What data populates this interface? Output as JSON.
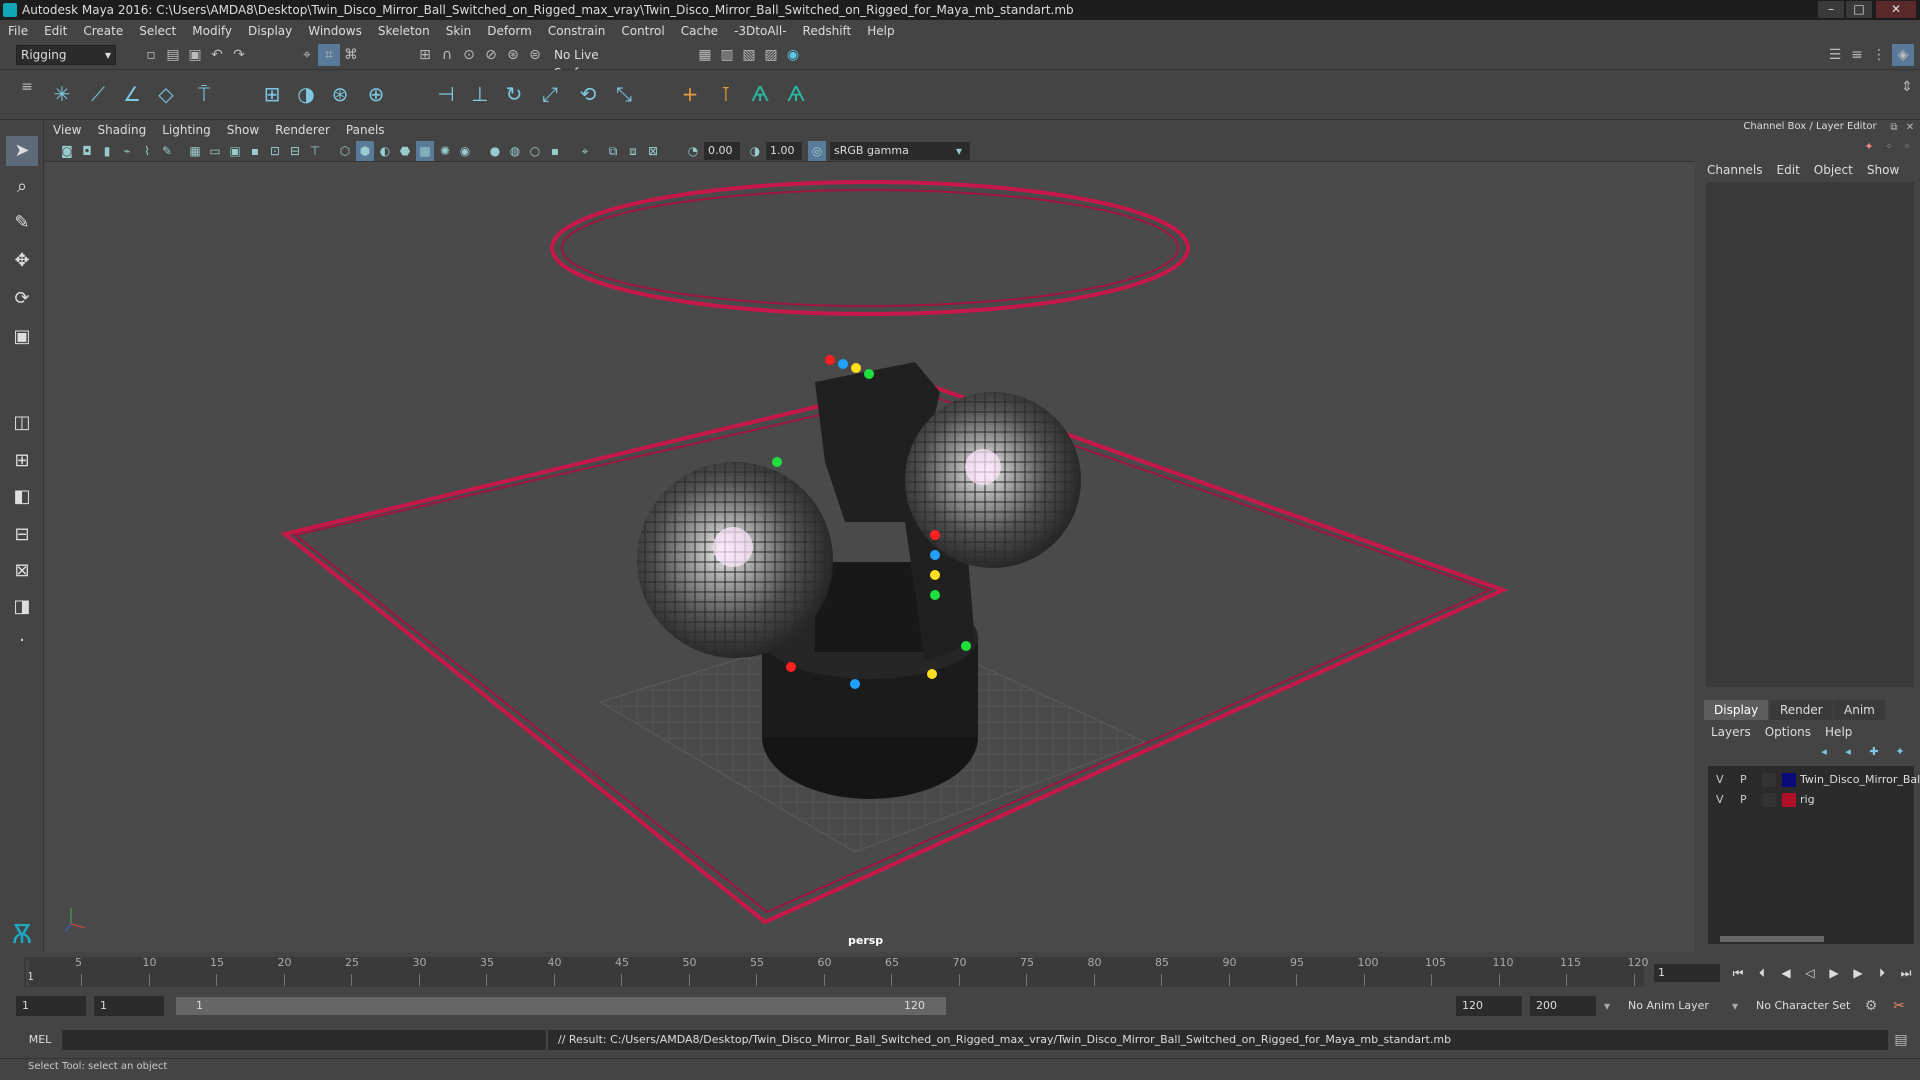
{
  "window": {
    "title": "Autodesk Maya 2016: C:\\Users\\AMDA8\\Desktop\\Twin_Disco_Mirror_Ball_Switched_on_Rigged_max_vray\\Twin_Disco_Mirror_Ball_Switched_on_Rigged_for_Maya_mb_standart.mb",
    "minimize": "–",
    "maximize": "□",
    "close": "✕"
  },
  "menubar": [
    "File",
    "Edit",
    "Create",
    "Select",
    "Modify",
    "Display",
    "Windows",
    "Skeleton",
    "Skin",
    "Deform",
    "Constrain",
    "Control",
    "Cache",
    "-3DtoAll-",
    "Redshift",
    "Help"
  ],
  "statusline": {
    "mode": "Rigging",
    "live_surface": "No Live Surface"
  },
  "panel": {
    "menu": [
      "View",
      "Shading",
      "Lighting",
      "Show",
      "Renderer",
      "Panels"
    ],
    "exposure": "0.00",
    "gamma_value": "1.00",
    "color_space": "sRGB gamma",
    "camera": "persp"
  },
  "channel_box": {
    "title": "Channel Box / Layer Editor",
    "menu": [
      "Channels",
      "Edit",
      "Object",
      "Show"
    ],
    "tabs": [
      "Display",
      "Render",
      "Anim"
    ],
    "layer_menu": [
      "Layers",
      "Options",
      "Help"
    ],
    "layers": [
      {
        "v": "V",
        "p": "P",
        "color": "#0a0a7a",
        "name": "Twin_Disco_Mirror_Bal"
      },
      {
        "v": "V",
        "p": "P",
        "color": "#b0102a",
        "name": "rig"
      }
    ]
  },
  "timeline": {
    "ticks": [
      "5",
      "10",
      "15",
      "20",
      "25",
      "30",
      "35",
      "40",
      "45",
      "50",
      "55",
      "60",
      "65",
      "70",
      "75",
      "80",
      "85",
      "90",
      "95",
      "100",
      "105",
      "110",
      "115",
      "120"
    ],
    "start_label": "1",
    "current_frame": "1"
  },
  "range": {
    "start": "1",
    "playback_start": "1",
    "slider_start": "1",
    "slider_end": "120",
    "playback_end": "120",
    "end": "200",
    "anim_layer": "No Anim Layer",
    "character_set": "No Character Set"
  },
  "cmdline": {
    "label": "MEL",
    "result": "// Result: C:/Users/AMDA8/Desktop/Twin_Disco_Mirror_Ball_Switched_on_Rigged_max_vray/Twin_Disco_Mirror_Ball_Switched_on_Rigged_for_Maya_mb_standart.mb"
  },
  "helpline": "Select Tool: select an object",
  "colors": {
    "rig": "#c8184a",
    "accent": "#5aa0c8",
    "bg": "#444444"
  }
}
